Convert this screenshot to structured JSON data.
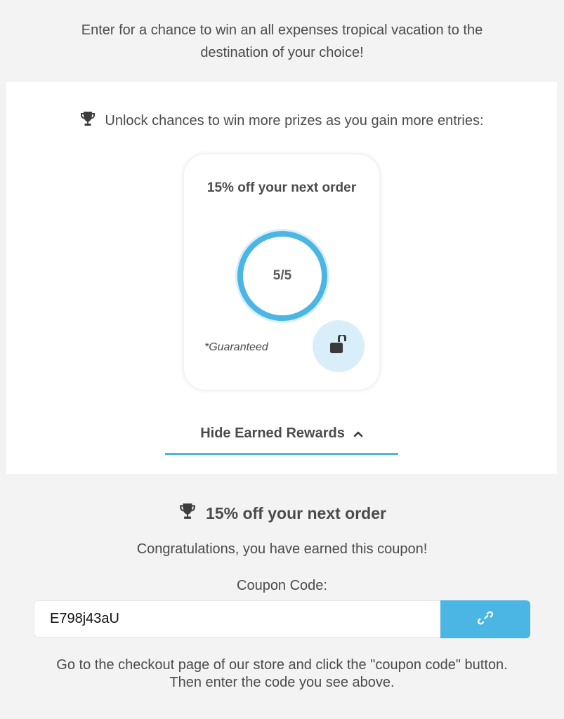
{
  "intro": {
    "text": "Enter for a chance to win an all expenses tropical vacation to the destination of your choice!"
  },
  "unlock": {
    "text": "Unlock chances to win more prizes as you gain more entries:",
    "icon": "trophy-icon"
  },
  "reward_card": {
    "title": "15% off your next order",
    "progress_text": "5/5",
    "progress_fraction": 1.0,
    "note": "*Guaranteed",
    "lock_icon": "unlocked-padlock-icon",
    "ring_color": "#4bb6e3",
    "lock_bg_color": "#d8eef9"
  },
  "toggle": {
    "label": "Hide Earned Rewards",
    "icon": "chevron-up-icon"
  },
  "earned": {
    "title": "15% off your next order",
    "icon": "trophy-icon",
    "congrats": "Congratulations, you have earned this coupon!",
    "coupon_label": "Coupon Code:",
    "coupon_code": "E798j43aU",
    "copy_icon": "link-icon",
    "instructions": "Go to the checkout page of our store and click the \"coupon code\" button. Then enter the code you see above."
  },
  "colors": {
    "accent": "#4bb6e3",
    "text": "#4b4b4b",
    "background": "#f3f3f3",
    "panel": "#ffffff"
  }
}
